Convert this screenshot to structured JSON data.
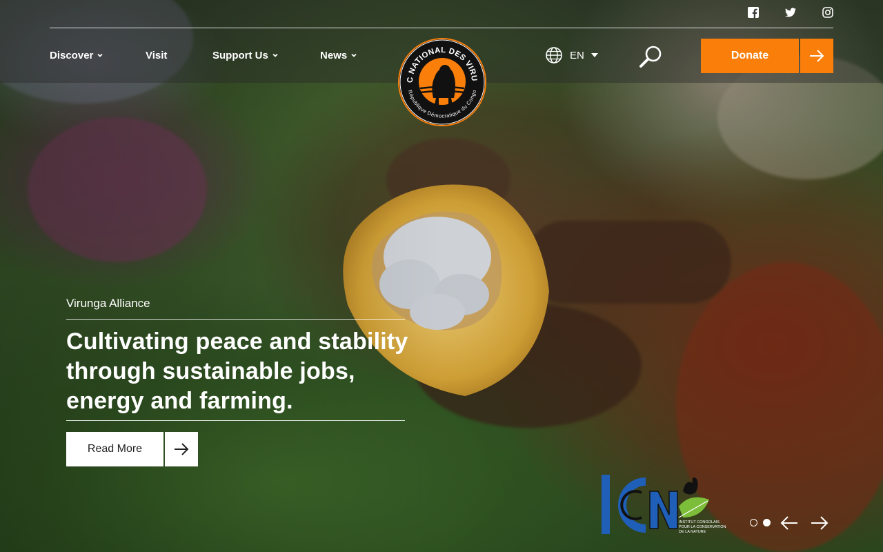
{
  "socials": [
    {
      "name": "facebook-icon"
    },
    {
      "name": "twitter-icon"
    },
    {
      "name": "instagram-icon"
    }
  ],
  "nav": {
    "items": [
      {
        "label": "Discover",
        "has_dropdown": true
      },
      {
        "label": "Visit",
        "has_dropdown": false
      },
      {
        "label": "Support Us",
        "has_dropdown": true
      },
      {
        "label": "News",
        "has_dropdown": true
      }
    ]
  },
  "logo": {
    "top_text": "PARC NATIONAL DES VIRUNGA",
    "bottom_text": "République Démocratique du Congo"
  },
  "language": {
    "current": "EN",
    "icon": "globe-icon"
  },
  "search": {
    "icon": "search-icon"
  },
  "donate": {
    "label": "Donate",
    "color": "#f97f0a"
  },
  "hero": {
    "kicker": "Virunga Alliance",
    "headline": "Cultivating peace and stability through sustainable jobs, energy and farming.",
    "cta_label": "Read More"
  },
  "partner": {
    "name": "ICCN",
    "caption_lines": [
      "INSTITUT CONGOLAIS",
      "POUR LA CONSERVATION",
      "DE LA NATURE"
    ]
  },
  "slider": {
    "total": 2,
    "active": 2
  }
}
